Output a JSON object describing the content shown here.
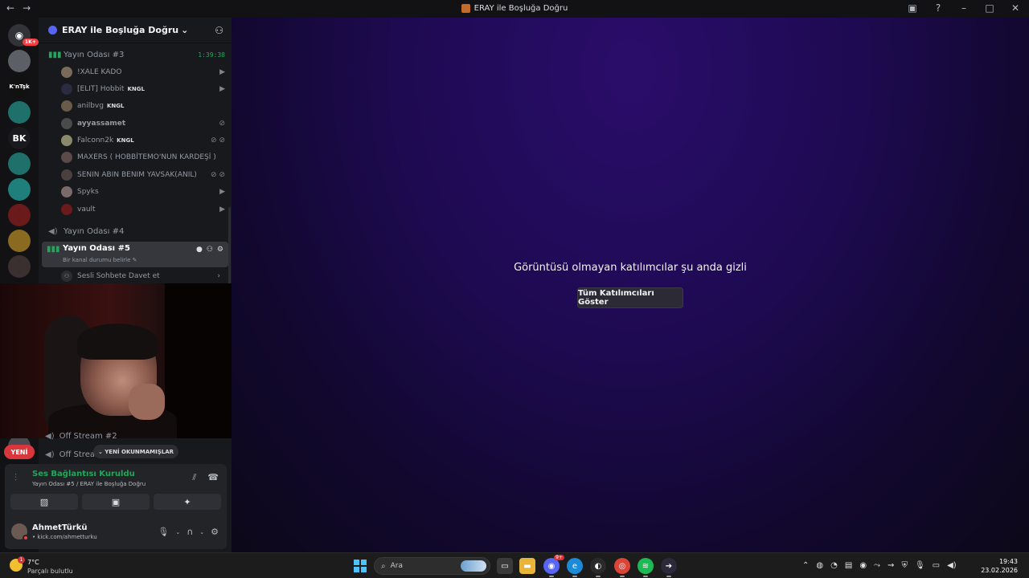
{
  "window": {
    "title": "ERAY ile Boşluğa Doğru",
    "back": "←",
    "forward": "→",
    "controls": {
      "inbox": "▣",
      "help": "?",
      "minimize": "–",
      "maximize": "□",
      "close": "✕"
    }
  },
  "guilds": {
    "badge": "1K+",
    "items": [
      {
        "label": ""
      },
      {
        "label": "K'nTşk"
      },
      {
        "label": ""
      },
      {
        "label": "BK"
      },
      {
        "label": ""
      },
      {
        "label": ""
      },
      {
        "label": ""
      },
      {
        "label": ""
      },
      {
        "label": ""
      }
    ]
  },
  "server": {
    "name": "ERAY ile Boşluğa Doğru",
    "chevron": "⌄"
  },
  "channels": {
    "room3": {
      "name": "Yayın Odası #3",
      "timer": "1:39:38"
    },
    "room3_members": [
      {
        "name": "!XALE KADO",
        "tag": "",
        "icons": "▶"
      },
      {
        "name": "[ELIT] Hobbit",
        "tag": "KNGL",
        "icons": "▶"
      },
      {
        "name": "anilbvg",
        "tag": "KNGL",
        "icons": ""
      },
      {
        "name": "ayyassamet",
        "tag": "",
        "icons": "⊘"
      },
      {
        "name": "Falconn2k",
        "tag": "KNGL",
        "icons": "⊘ ⊘"
      },
      {
        "name": "MAXERS ( HOBBİTEMO'NUN KARDEŞİ )",
        "tag": "",
        "icons": ""
      },
      {
        "name": "SENIN ABIN BENIM YAVSAK(ANIL)",
        "tag": "",
        "icons": "⊘ ⊘"
      },
      {
        "name": "Spyks",
        "tag": "",
        "icons": "▶"
      },
      {
        "name": "vault",
        "tag": "",
        "icons": "▶"
      }
    ],
    "room4": {
      "name": "Yayın Odası #4"
    },
    "room5": {
      "name": "Yayın Odası #5",
      "status": "Bir kanal durumu belirle ✎"
    },
    "invite": "Sesli Sohbete Davet et",
    "off2": "Off Stream #2",
    "off3": "Off Strea"
  },
  "new_badge": "YENİ",
  "unread": "⌄ YENİ OKUNMAMIŞLAR",
  "voice": {
    "status": "Ses Bağlantısı Kuruldu",
    "location": "Yayın Odası #5 / ERAY ile Boşluğa Doğru"
  },
  "user": {
    "name": "AhmetTürkü",
    "status": "• kick.com/ahmetturku"
  },
  "stage": {
    "message": "Görüntüsü olmayan katılımcılar şu anda gizli",
    "button": "Tüm Katılımcıları Göster"
  },
  "taskbar": {
    "temp": "7°C",
    "condition": "Parçalı bulutlu",
    "weather_badge": "1",
    "search": "Ara",
    "discord_badge": "9+",
    "time": "19:43",
    "date": "23.02.2026"
  },
  "colors": {
    "accent_green": "#23a55a",
    "danger": "#da373c",
    "blurple": "#5865f2"
  }
}
